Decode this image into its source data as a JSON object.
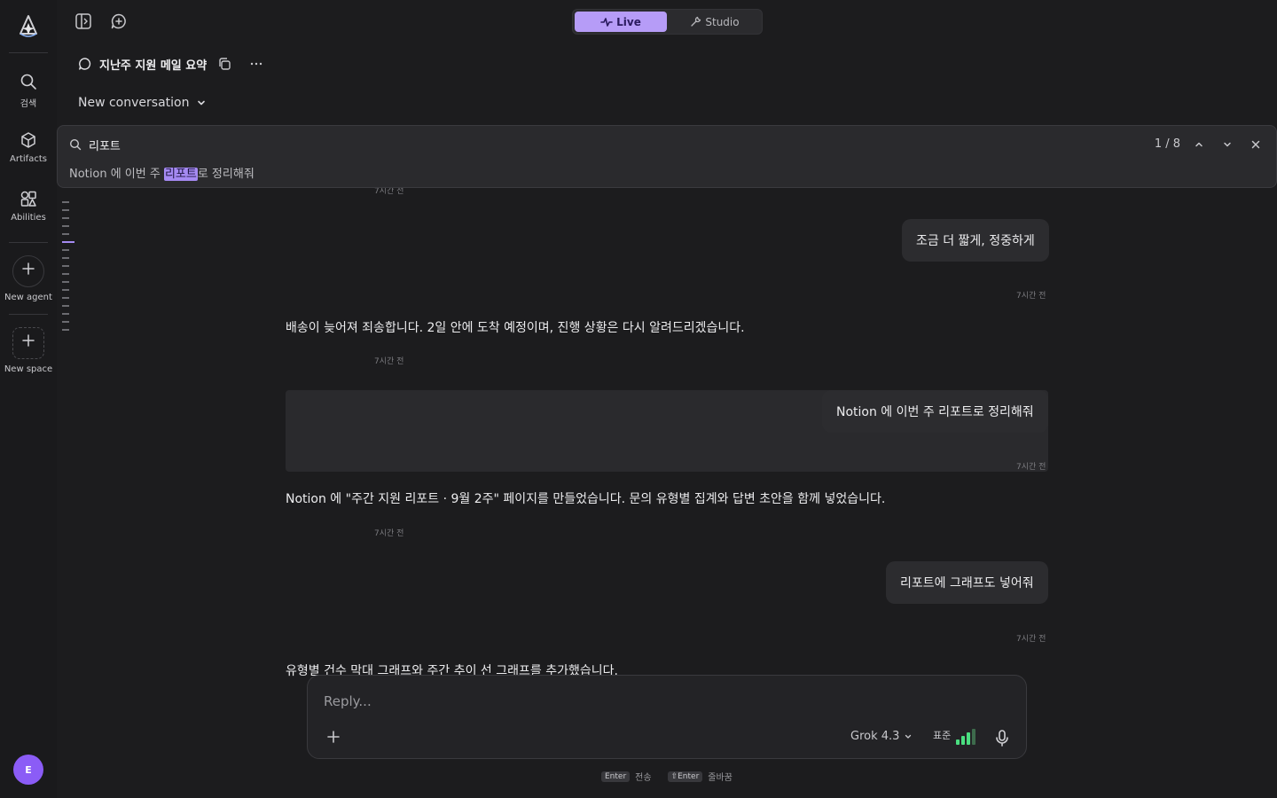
{
  "rail": {
    "search_label": "검색",
    "artifacts_label": "Artifacts",
    "abilities_label": "Abilities",
    "new_agent_label": "New agent",
    "new_space_label": "New space",
    "avatar_initial": "E"
  },
  "topbar": {
    "live_label": "Live",
    "studio_label": "Studio",
    "active_mode": "Live"
  },
  "chat": {
    "title": "지난주 지원 메일 요약",
    "conversation_select": "New conversation"
  },
  "find": {
    "query": "리포트",
    "count": "1 / 8",
    "result_prefix": "Notion 에 이번 주 ",
    "result_match": "리포트",
    "result_suffix": "로 정리해줘"
  },
  "messages": {
    "ts_top": "7시간 전",
    "user1": "조금 더 짧게, 정중하게",
    "ts_user1": "7시간 전",
    "assistant1": "배송이 늦어져 죄송합니다. 2일 안에 도착 예정이며, 진행 상황은 다시 알려드리겠습니다.",
    "ts_assistant1": "7시간 전",
    "user2": "Notion 에 이번 주 리포트로 정리해줘",
    "ts_user2": "7시간 전",
    "assistant2": "Notion 에 \"주간 지원 리포트 · 9월 2주\" 페이지를 만들었습니다. 문의 유형별 집계와 답변 초안을 함께 넣었습니다.",
    "ts_assistant2": "7시간 전",
    "user3": "리포트에 그래프도 넣어줘",
    "ts_user3": "7시간 전",
    "assistant3": "유형별 건수 막대 그래프와 주간 추이 선 그래프를 추가했습니다."
  },
  "composer": {
    "placeholder": "Reply...",
    "model": "Grok 4.3",
    "effort_label": "표준",
    "effort_level": 0.75
  },
  "hints": {
    "send_key": "Enter",
    "send_label": "전송",
    "newline_key": "⇧Enter",
    "newline_label": "줄바꿈"
  },
  "colors": {
    "accent": "#a58af2",
    "background": "#1c1c1e",
    "bubble": "#2c2c2f",
    "effort_bars": "#4ade80"
  }
}
